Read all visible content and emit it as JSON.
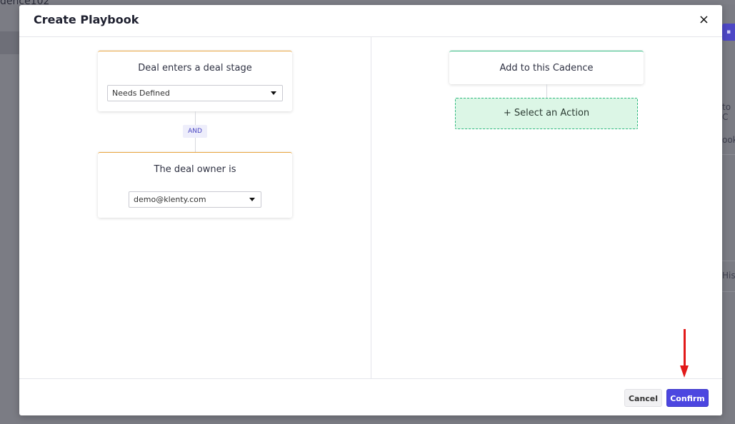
{
  "background": {
    "title_fragment": "dence102",
    "right_fragments": [
      "to C",
      "ook",
      "His"
    ]
  },
  "modal": {
    "title": "Create Playbook",
    "close_label": "×"
  },
  "trigger": {
    "stage_title": "Deal enters a deal stage",
    "stage_value": "Needs Defined",
    "connector_label": "AND",
    "owner_title": "The deal owner is",
    "owner_value": "demo@klenty.com"
  },
  "action": {
    "cadence_title": "Add to this Cadence",
    "select_action_label": "+ Select an Action"
  },
  "footer": {
    "cancel_label": "Cancel",
    "confirm_label": "Confirm"
  },
  "colors": {
    "accent": "#4c46e0",
    "trigger_border": "#e8a33c",
    "action_border": "#2fb97f",
    "action_fill": "#dcf6e6",
    "annotation_arrow": "#e21a1a"
  }
}
